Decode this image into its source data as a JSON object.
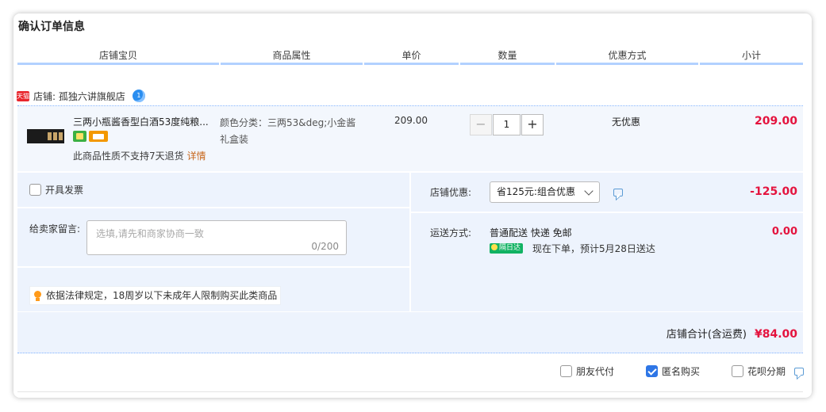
{
  "title": "确认订单信息",
  "columns": [
    "店铺宝贝",
    "商品属性",
    "单价",
    "数量",
    "优惠方式",
    "小计"
  ],
  "shop": {
    "badge": "天猫",
    "label": "店铺: 孤独六讲旗舰店",
    "ww_badge": "1"
  },
  "item": {
    "name": "三两小瓶酱香型白酒53度纯粮...",
    "attr": "颜色分类：三两53&deg;小金酱礼盒装",
    "price": "209.00",
    "quantity": "1",
    "minus": "−",
    "plus": "+",
    "discount": "无优惠",
    "subtotal": "209.00",
    "note": "此商品性质不支持7天退货",
    "note_link": "详情"
  },
  "invoice": {
    "label": "开具发票",
    "checked": false
  },
  "message": {
    "label": "给卖家留言:",
    "placeholder": "选填,请先和商家协商一致",
    "counter": "0/200"
  },
  "law_notice": "依据法律规定，18周岁以下未成年人限制购买此类商品",
  "shop_discount": {
    "label": "店铺优惠:",
    "selected": "省125元:组合优惠",
    "amount": "-125.00"
  },
  "shipping": {
    "label": "运送方式:",
    "method": "普通配送 快递 免邮",
    "badge": "隔日达",
    "eta": "现在下单，预计5月28日送达",
    "fee": "0.00"
  },
  "total": {
    "label": "店铺合计(含运费)",
    "value": "¥84.00"
  },
  "bottom_options": [
    {
      "label": "朋友代付",
      "checked": false
    },
    {
      "label": "匿名购买",
      "checked": true
    },
    {
      "label": "花呗分期",
      "checked": false
    }
  ],
  "colors": {
    "accent": "#2e76e6",
    "price_red": "#e4133e",
    "panel": "#edf3fd"
  }
}
